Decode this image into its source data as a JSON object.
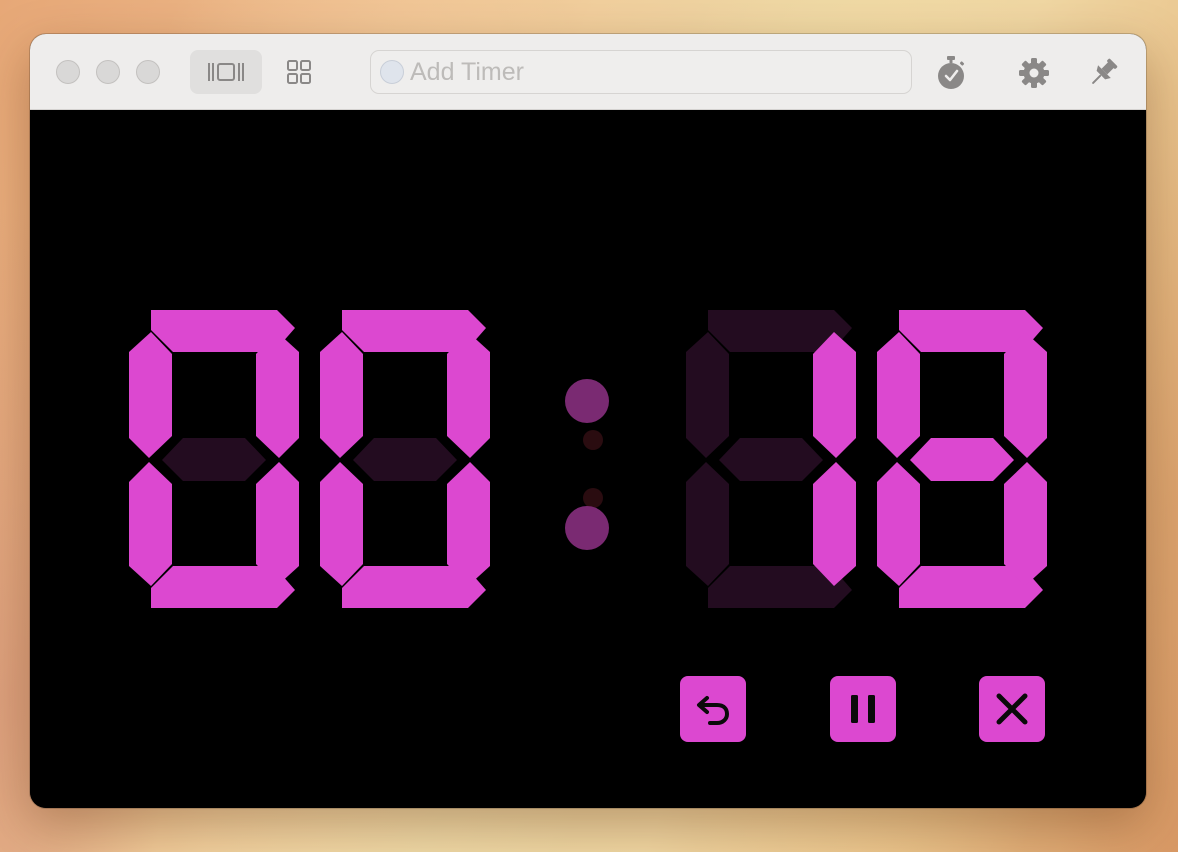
{
  "toolbar": {
    "search_placeholder": "Add Timer",
    "single_view_icon": "single-timer-view-icon",
    "grid_view_icon": "grid-view-icon",
    "stopwatch_icon": "stopwatch-icon",
    "settings_icon": "gear-icon",
    "pin_icon": "pin-icon"
  },
  "timer": {
    "display": "00:18",
    "digits": [
      "0",
      "0",
      "1",
      "8"
    ],
    "segment_on_color": "#dc48d0",
    "segment_off_color": "#230c20",
    "colon_color": "#7a2a72",
    "colon_dim_color": "#2a0c10"
  },
  "controls": {
    "reset_icon": "undo-arrow-icon",
    "pause_icon": "pause-icon",
    "stop_icon": "close-icon",
    "button_color": "#dc48d0"
  }
}
